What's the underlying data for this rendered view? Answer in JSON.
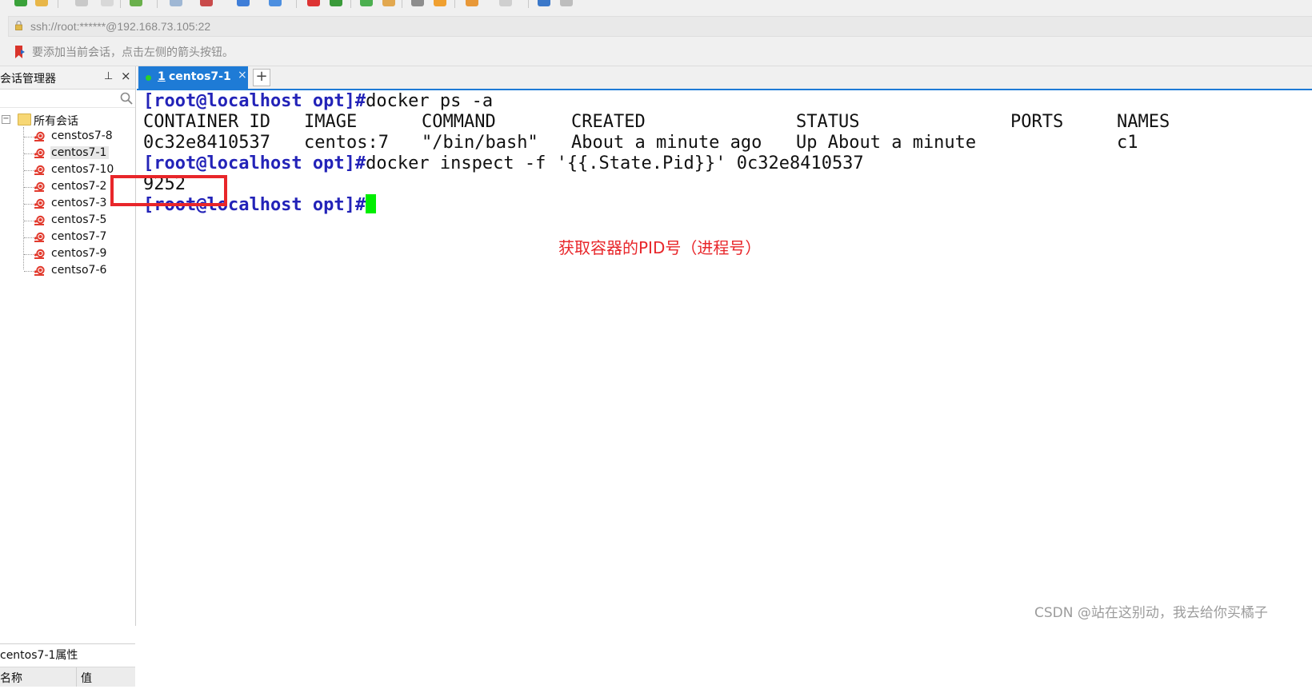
{
  "address_bar": {
    "url": "ssh://root:******@192.168.73.105:22"
  },
  "hint_bar": {
    "text": "要添加当前会话，点击左侧的箭头按钮。"
  },
  "session_manager": {
    "title": "会话管理器",
    "root_folder": "所有会话",
    "sessions": [
      "censtos7-8",
      "centos7-1",
      "centos7-10",
      "centos7-2",
      "centos7-3",
      "centos7-5",
      "centos7-7",
      "centos7-9",
      "centso7-6"
    ],
    "selected_session": "centos7-1"
  },
  "properties_panel": {
    "title": "centos7-1属性",
    "columns": [
      "名称",
      "值"
    ]
  },
  "tabs": [
    {
      "number": "1",
      "label": "centos7-1",
      "active": true
    }
  ],
  "terminal": {
    "prompt": "[root@localhost opt]#",
    "command1": "docker ps -a",
    "table_headers": [
      "CONTAINER ID",
      "IMAGE",
      "COMMAND",
      "CREATED",
      "STATUS",
      "PORTS",
      "NAMES"
    ],
    "table_rows": [
      [
        "0c32e8410537",
        "centos:7",
        "\"/bin/bash\"",
        "About a minute ago",
        "Up About a minute",
        "",
        "c1"
      ]
    ],
    "command2": "docker inspect -f '{{.State.Pid}}' 0c32e8410537",
    "output_pid": "9252"
  },
  "annotation": {
    "text": "获取容器的PID号（进程号）"
  },
  "watermark": {
    "text": "CSDN @站在这别动，我去给你买橘子"
  },
  "colors": {
    "accent": "#1e7bd6",
    "prompt": "#2323b8",
    "cursor": "#00ee00",
    "annotation": "#e8262a",
    "status_dot": "#2bd12b"
  }
}
